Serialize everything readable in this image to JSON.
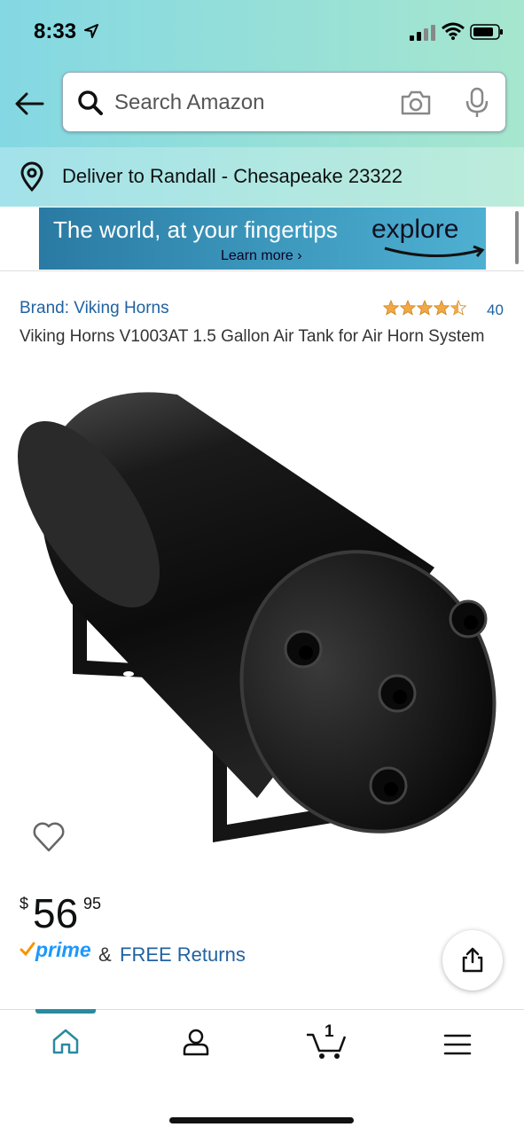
{
  "status_bar": {
    "time": "8:33",
    "location_icon": "location-arrow-icon",
    "signal_icon": "cellular-signal-icon",
    "wifi_icon": "wifi-icon",
    "battery_icon": "battery-icon"
  },
  "header": {
    "back_icon": "back-arrow-icon",
    "search_placeholder": "Search Amazon",
    "search_icon": "search-icon",
    "camera_icon": "camera-icon",
    "mic_icon": "microphone-icon",
    "deliver_text": "Deliver to Randall - Chesapeake 23322"
  },
  "banner": {
    "headline": "The world, at your fingertips",
    "cta": "explore",
    "learn_more": "Learn more ›"
  },
  "product": {
    "brand": "Brand: Viking Horns",
    "rating_stars": 4.5,
    "rating_count": "40",
    "title": "Viking Horns V1003AT 1.5 Gallon Air Tank for Air Horn System",
    "image_description_icon": "air-tank-product-image",
    "price_symbol": "$",
    "price_whole": "56",
    "price_fraction": "95",
    "prime_label": "prime",
    "amp": "&",
    "returns": "FREE Returns"
  },
  "bottom_nav": {
    "items": [
      {
        "icon": "home-icon",
        "active": true
      },
      {
        "icon": "account-icon",
        "active": false
      },
      {
        "icon": "cart-icon",
        "badge": "1",
        "active": false
      },
      {
        "icon": "menu-icon",
        "active": false
      }
    ]
  },
  "colors": {
    "accent": "#2a8aa0",
    "link": "#2162a1",
    "prime": "#1a98ff",
    "star": "#f3a847"
  }
}
